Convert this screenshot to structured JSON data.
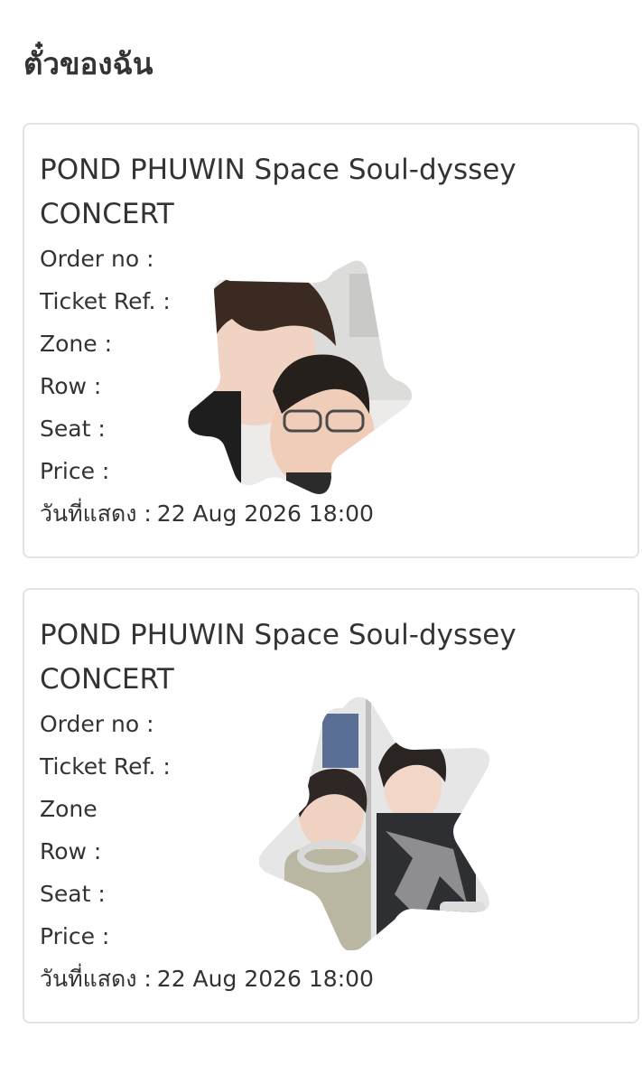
{
  "page": {
    "title": "ตั๋วของฉัน"
  },
  "tickets": [
    {
      "event_title": "POND PHUWIN Space Soul-dyssey CONCERT",
      "order_label": "Order no :",
      "ticket_ref_label": "Ticket Ref. :",
      "zone_label": "Zone :",
      "row_label": "Row :",
      "seat_label": "Seat :",
      "price_label": "Price :",
      "show_date_label": "วันที่แสดง :",
      "show_date_value": "22 Aug 2026 18:00"
    },
    {
      "event_title": "POND PHUWIN Space Soul-dyssey CONCERT",
      "order_label": "Order no :",
      "ticket_ref_label": "Ticket Ref. :",
      "zone_label": "Zone",
      "row_label": "Row :",
      "seat_label": "Seat :",
      "price_label": "Price :",
      "show_date_label": "วันที่แสดง :",
      "show_date_value": "22 Aug 2026 18:00"
    }
  ],
  "colors": {
    "text": "#333333",
    "card_border": "#e3e3e3",
    "background": "#ffffff"
  }
}
